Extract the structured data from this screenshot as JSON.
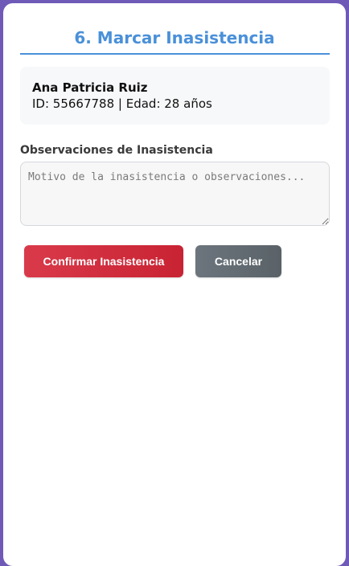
{
  "page": {
    "title": "6. Marcar Inasistencia"
  },
  "patient": {
    "name": "Ana Patricia Ruiz",
    "details": "ID: 55667788 | Edad: 28 años"
  },
  "observations": {
    "label": "Observaciones de Inasistencia",
    "placeholder": "Motivo de la inasistencia o observaciones...",
    "value": ""
  },
  "actions": {
    "confirm_label": "Confirmar Inasistencia",
    "cancel_label": "Cancelar"
  },
  "colors": {
    "background": "#6f5ab8",
    "accent": "#4a90d9",
    "confirm": "#dc3545",
    "cancel": "#6c757d"
  }
}
